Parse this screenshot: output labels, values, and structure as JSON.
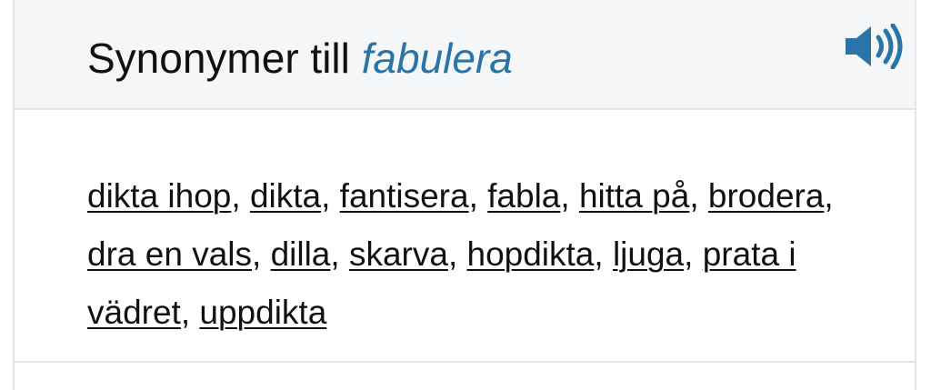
{
  "header": {
    "title_prefix": "Synonymer till",
    "word": "fabulera",
    "speaker_icon": "speaker-volume-icon"
  },
  "synonyms": [
    "dikta ihop",
    "dikta",
    "fantisera",
    "fabla",
    "hitta på",
    "brodera",
    "dra en vals",
    "dilla",
    "skarva",
    "hopdikta",
    "ljuga",
    "prata i vädret",
    "uppdikta"
  ],
  "colors": {
    "accent": "#2a74a8",
    "header_bg": "#f4f6f8",
    "border": "#e3e6e9",
    "text": "#111111"
  }
}
